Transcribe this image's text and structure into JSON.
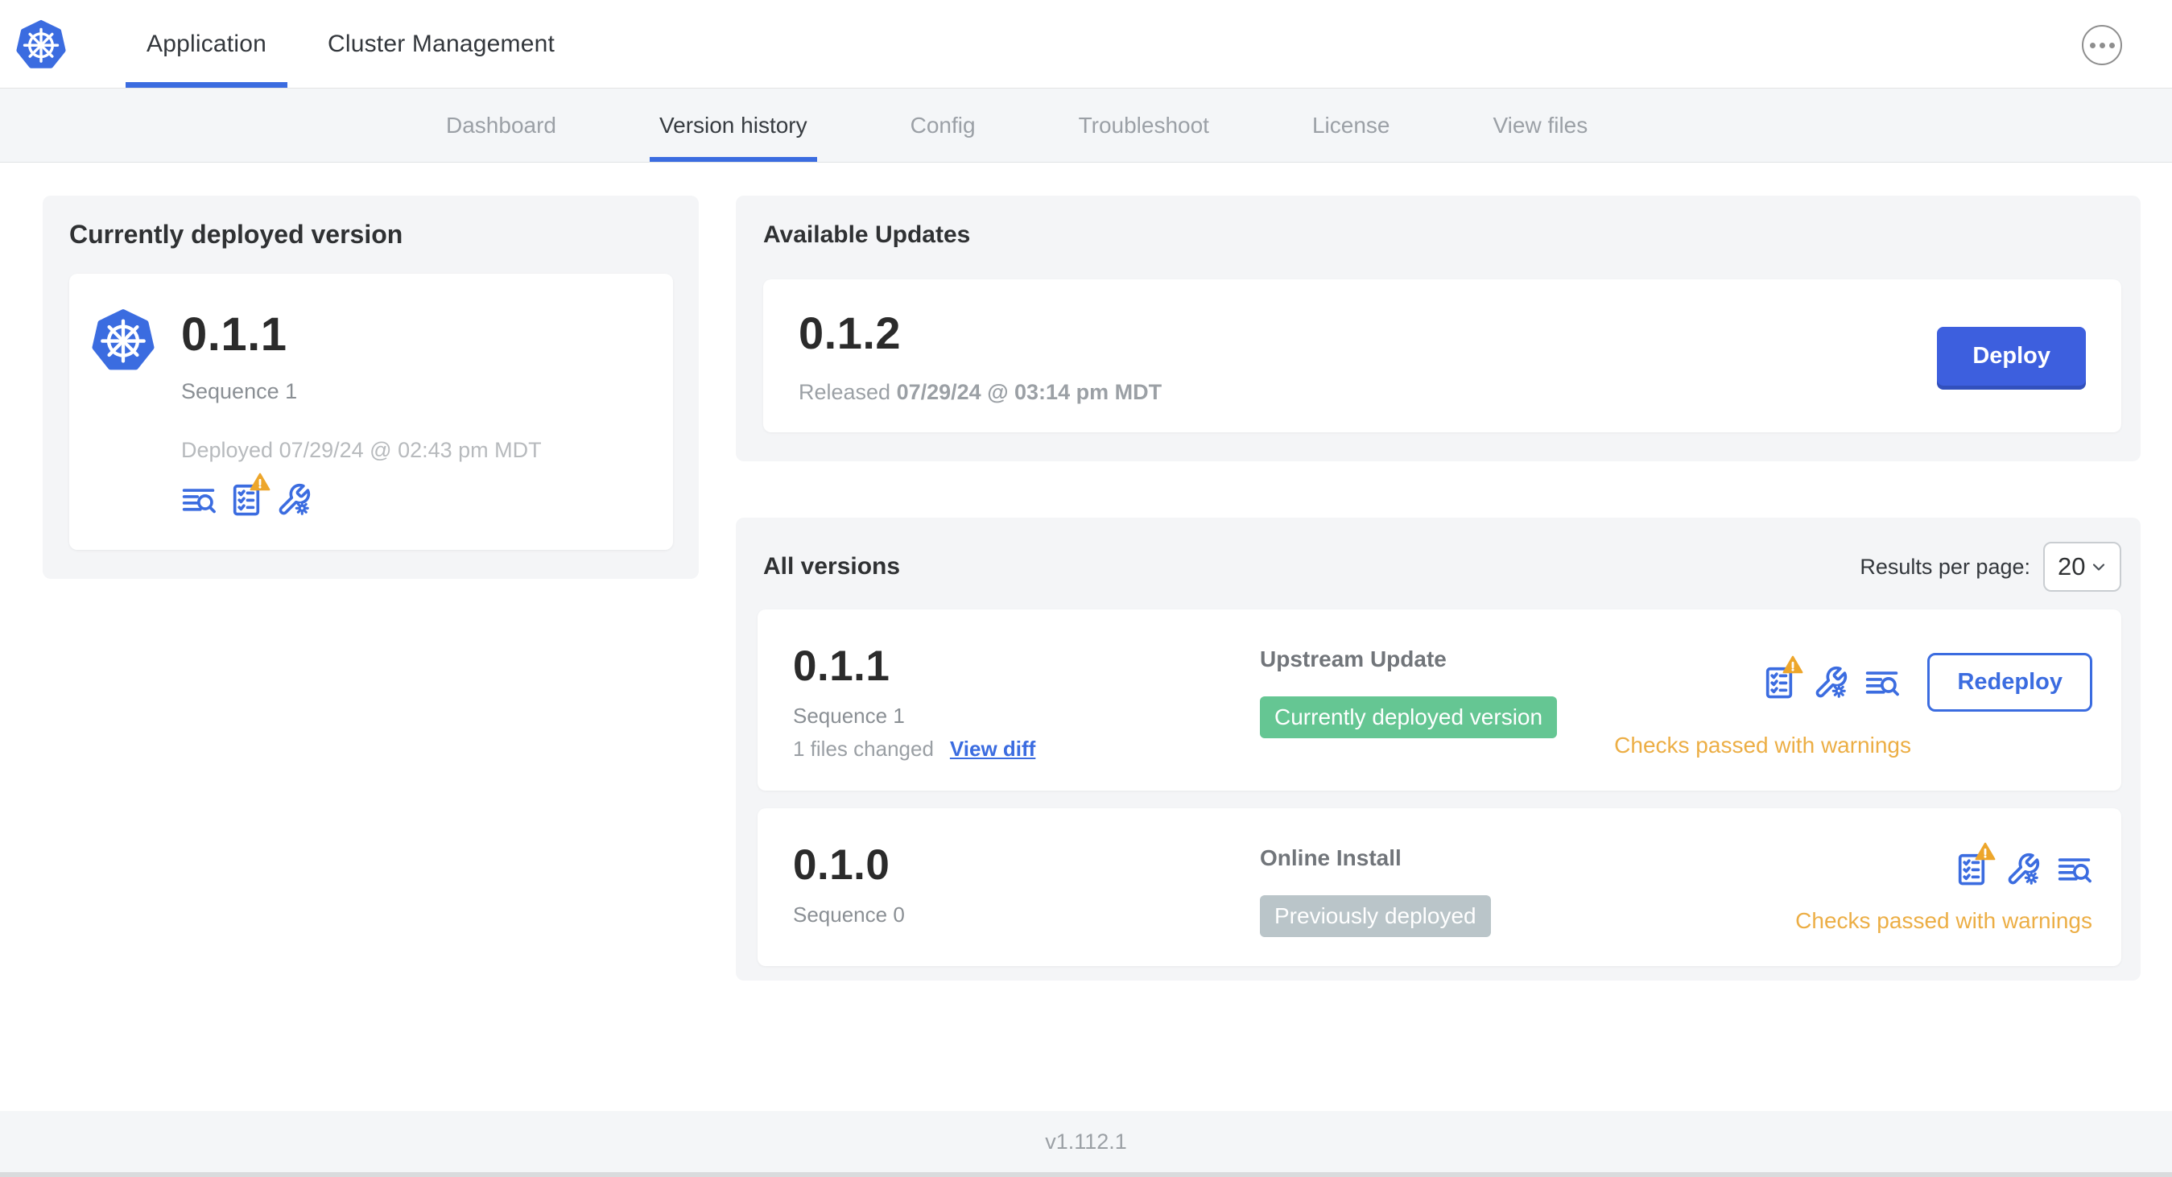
{
  "topnav": {
    "tabs": [
      {
        "label": "Application",
        "active": true
      },
      {
        "label": "Cluster Management",
        "active": false
      }
    ]
  },
  "subnav": {
    "active": "Version history",
    "tabs": [
      "Dashboard",
      "Version history",
      "Config",
      "Troubleshoot",
      "License",
      "View files"
    ]
  },
  "current_version": {
    "title": "Currently deployed version",
    "version": "0.1.1",
    "sequence": "Sequence 1",
    "deployed": "Deployed 07/29/24 @ 02:43 pm MDT"
  },
  "available_updates": {
    "title": "Available Updates",
    "version": "0.1.2",
    "released_prefix": "Released",
    "released_date": "07/29/24 @ 03:14 pm MDT",
    "deploy_label": "Deploy"
  },
  "all_versions": {
    "title": "All versions",
    "results_per_page_label": "Results per page:",
    "results_per_page_value": "20",
    "rows": [
      {
        "version": "0.1.1",
        "sequence": "Sequence 1",
        "files_changed": "1 files changed",
        "view_diff_label": "View diff",
        "source": "Upstream Update",
        "badge": "Currently deployed version",
        "badge_color": "#65C693",
        "action_label": "Redeploy",
        "checks": "Checks passed with warnings"
      },
      {
        "version": "0.1.0",
        "sequence": "Sequence 0",
        "source": "Online Install",
        "badge": "Previously deployed",
        "badge_color": "#BAC5C9",
        "checks": "Checks passed with warnings"
      }
    ]
  },
  "footer": {
    "version": "v1.112.1"
  },
  "colors": {
    "accent_blue": "#3B6CE0",
    "button_blue": "#3D5FDE",
    "warning_amber": "#EDA62B",
    "warning_text": "#ECAE45",
    "badge_green": "#65C693",
    "badge_gray": "#BAC5C9"
  },
  "icons": {
    "logo": "kubernetes-logo",
    "more": "ellipsis-icon",
    "diff_log": "diff-log-icon",
    "preflight": "preflight-checks-icon",
    "config_wrench": "config-wrench-icon",
    "warning": "warning-triangle-icon",
    "chevron": "chevron-down-icon"
  }
}
